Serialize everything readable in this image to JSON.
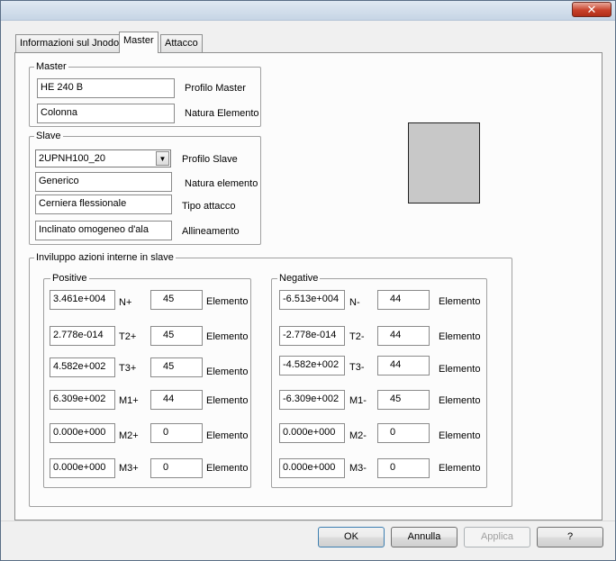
{
  "titlebar": {
    "close_label": "✕"
  },
  "tabs": [
    {
      "label": "Informazioni sul Jnodo"
    },
    {
      "label": "Master"
    },
    {
      "label": "Attacco"
    }
  ],
  "master": {
    "group_title": "Master",
    "profilo_value": "HE 240 B",
    "profilo_label": "Profilo Master",
    "natura_value": "Colonna",
    "natura_label": "Natura Elemento"
  },
  "slave": {
    "group_title": "Slave",
    "profilo_value": "2UPNH100_20",
    "profilo_label": "Profilo Slave",
    "natura_value": "Generico",
    "natura_label": "Natura elemento",
    "attacco_value": "Cerniera flessionale",
    "attacco_label": "Tipo attacco",
    "allineamento_value": "Inclinato omogeneo d'ala",
    "allineamento_label": "Allineamento"
  },
  "inviluppo": {
    "group_title": "Inviluppo azioni interne in slave",
    "positive_title": "Positive",
    "negative_title": "Negative",
    "element_label": "Elemento",
    "positive": [
      {
        "value": "3.461e+004",
        "label": "N+",
        "element": "45"
      },
      {
        "value": "2.778e-014",
        "label": "T2+",
        "element": "45"
      },
      {
        "value": "4.582e+002",
        "label": "T3+",
        "element": "45"
      },
      {
        "value": "6.309e+002",
        "label": "M1+",
        "element": "44"
      },
      {
        "value": "0.000e+000",
        "label": "M2+",
        "element": "0"
      },
      {
        "value": "0.000e+000",
        "label": "M3+",
        "element": "0"
      }
    ],
    "negative": [
      {
        "value": "-6.513e+004",
        "label": "N-",
        "element": "44"
      },
      {
        "value": "-2.778e-014",
        "label": "T2-",
        "element": "44"
      },
      {
        "value": "-4.582e+002",
        "label": "T3-",
        "element": "44"
      },
      {
        "value": "-6.309e+002",
        "label": "M1-",
        "element": "45"
      },
      {
        "value": "0.000e+000",
        "label": "M2-",
        "element": "0"
      },
      {
        "value": "0.000e+000",
        "label": "M3-",
        "element": "0"
      }
    ]
  },
  "buttons": {
    "ok": "OK",
    "annulla": "Annulla",
    "applica": "Applica",
    "help": "?"
  }
}
